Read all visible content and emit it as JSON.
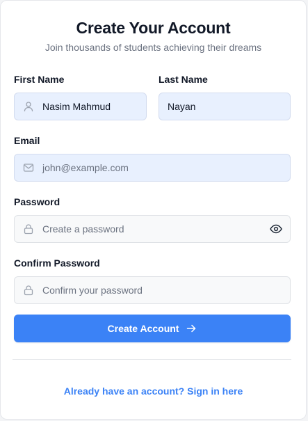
{
  "header": {
    "title": "Create Your Account",
    "subtitle": "Join thousands of students achieving their dreams"
  },
  "form": {
    "first_name": {
      "label": "First Name",
      "value": "Nasim Mahmud",
      "icon": "user-icon"
    },
    "last_name": {
      "label": "Last Name",
      "value": "Nayan"
    },
    "email": {
      "label": "Email",
      "placeholder": "john@example.com",
      "icon": "mail-icon"
    },
    "password": {
      "label": "Password",
      "placeholder": "Create a password",
      "icon": "lock-icon",
      "toggle_icon": "eye-icon"
    },
    "confirm_password": {
      "label": "Confirm Password",
      "placeholder": "Confirm your password",
      "icon": "lock-icon"
    },
    "submit_label": "Create Account",
    "submit_icon": "arrow-right-icon"
  },
  "footer": {
    "signin_link": "Already have an account? Sign in here"
  },
  "colors": {
    "primary": "#3b82f6",
    "filled_field_bg": "#e8f0fe",
    "empty_field_bg": "#f8f9fa",
    "text": "#111827",
    "muted": "#6b7280"
  }
}
